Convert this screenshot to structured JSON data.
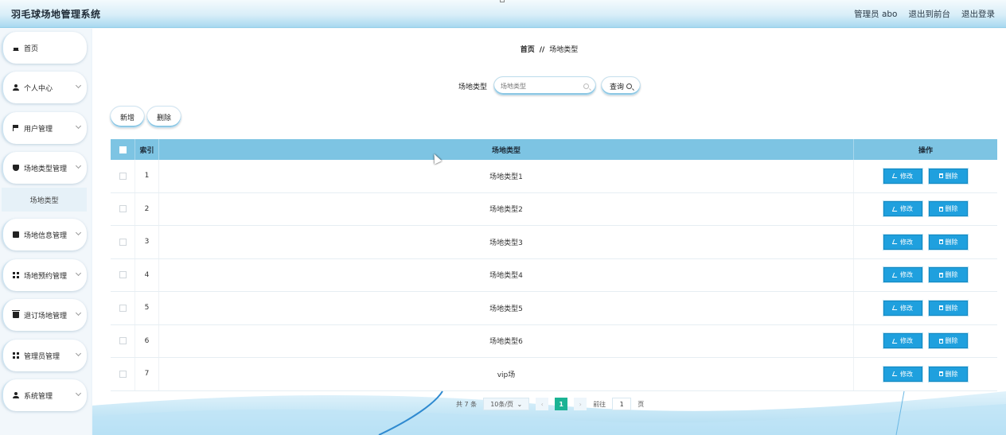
{
  "app": {
    "title": "羽毛球场地管理系统"
  },
  "header": {
    "user": "管理员 abo",
    "to_front": "退出到前台",
    "logout": "退出登录"
  },
  "sidebar": {
    "items": [
      {
        "label": "首页",
        "icon": "home-icon",
        "has_chevron": false
      },
      {
        "label": "个人中心",
        "icon": "user-icon",
        "has_chevron": true
      },
      {
        "label": "用户管理",
        "icon": "flag-icon",
        "has_chevron": true
      },
      {
        "label": "场地类型管理",
        "icon": "shield-icon",
        "has_chevron": true
      },
      {
        "label": "场地信息管理",
        "icon": "checkbox-icon",
        "has_chevron": true
      },
      {
        "label": "场地预约管理",
        "icon": "grid-icon",
        "has_chevron": true
      },
      {
        "label": "退订场地管理",
        "icon": "trash-icon",
        "has_chevron": true
      },
      {
        "label": "管理员管理",
        "icon": "grid-icon",
        "has_chevron": true
      },
      {
        "label": "系统管理",
        "icon": "user-icon",
        "has_chevron": true
      }
    ],
    "sub_item": "场地类型"
  },
  "breadcrumb": {
    "home": "首页",
    "separator": "//",
    "current": "场地类型"
  },
  "search": {
    "label": "场地类型",
    "placeholder": "场地类型",
    "query_button": "查询"
  },
  "actions": {
    "add": "新增",
    "delete": "删除"
  },
  "table": {
    "headers": {
      "index": "索引",
      "type": "场地类型",
      "ops": "操作"
    },
    "edit_label": "修改",
    "delete_label": "删除",
    "rows": [
      {
        "index": "1",
        "type": "场地类型1"
      },
      {
        "index": "2",
        "type": "场地类型2"
      },
      {
        "index": "3",
        "type": "场地类型3"
      },
      {
        "index": "4",
        "type": "场地类型4"
      },
      {
        "index": "5",
        "type": "场地类型5"
      },
      {
        "index": "6",
        "type": "场地类型6"
      },
      {
        "index": "7",
        "type": "vip场"
      }
    ]
  },
  "pagination": {
    "total": "共 7 条",
    "page_size": "10条/页",
    "prev": "‹",
    "current": "1",
    "next": "›",
    "goto_label": "前往",
    "goto_value": "1",
    "page_suffix": "页"
  },
  "colors": {
    "header_accent": "#7dc4e3",
    "button_blue": "#1fa0de",
    "page_active": "#1bb394"
  }
}
